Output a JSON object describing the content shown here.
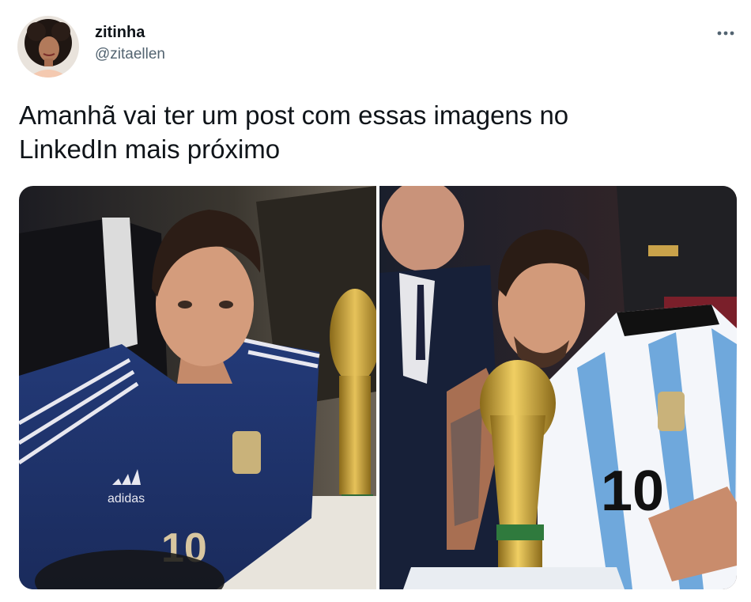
{
  "user": {
    "display_name": "zitinha",
    "handle": "@zitaellen"
  },
  "tweet": {
    "text": "Amanhã vai ter um post com essas imagens no\nLinkedIn mais próximo"
  },
  "media": {
    "left": {
      "shirt_number": "10",
      "brand": "adidas"
    },
    "right": {
      "shirt_number": "10"
    }
  },
  "icons": {
    "more": "more-horizontal-icon"
  }
}
